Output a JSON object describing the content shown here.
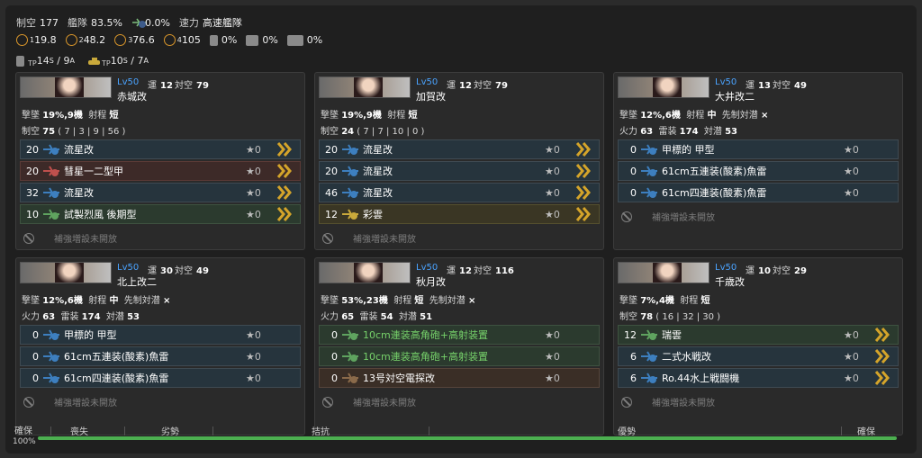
{
  "header": {
    "row1": [
      {
        "label": "制空",
        "value": "177"
      },
      {
        "label": "艦隊",
        "value": "83.5%"
      },
      {
        "label": "",
        "value": "0.0%"
      },
      {
        "label": "速力",
        "value": "高速艦隊"
      }
    ],
    "row2": [
      "19.8",
      "48.2",
      "76.6",
      "105",
      "0%",
      "0%",
      "0%"
    ],
    "row2_subs": [
      "1",
      "2",
      "3",
      "4"
    ],
    "row3": {
      "tp1_a": "14",
      "tp1_b": "9",
      "tp2_a": "10",
      "tp2_b": "7"
    }
  },
  "ships": [
    {
      "level": "Lv50",
      "luck_label": "運",
      "luck": "12",
      "aa_label": "対空",
      "aa": "79",
      "name": "赤城改",
      "stat1": {
        "label1": "撃墜",
        "v1": "19%,9機",
        "label2": "射程",
        "v2": "短"
      },
      "stat2": {
        "label1": "制空",
        "v1": "75",
        "extra": "( 7 | 3 | 9 | 56 )"
      },
      "equips": [
        {
          "slot": "20",
          "name": "流星改",
          "star": "★0",
          "style": "blue",
          "chev": true
        },
        {
          "slot": "20",
          "name": "彗星一二型甲",
          "star": "★0",
          "style": "red",
          "chev": true
        },
        {
          "slot": "32",
          "name": "流星改",
          "star": "★0",
          "style": "blue",
          "chev": true
        },
        {
          "slot": "10",
          "name": "試製烈風 後期型",
          "star": "★0",
          "style": "green",
          "chev": true
        }
      ],
      "ex": "補強増設未開放"
    },
    {
      "level": "Lv50",
      "luck_label": "運",
      "luck": "12",
      "aa_label": "対空",
      "aa": "79",
      "name": "加賀改",
      "stat1": {
        "label1": "撃墜",
        "v1": "19%,9機",
        "label2": "射程",
        "v2": "短"
      },
      "stat2": {
        "label1": "制空",
        "v1": "24",
        "extra": "( 7 | 7 | 10 | 0 )"
      },
      "equips": [
        {
          "slot": "20",
          "name": "流星改",
          "star": "★0",
          "style": "blue",
          "chev": true
        },
        {
          "slot": "20",
          "name": "流星改",
          "star": "★0",
          "style": "blue",
          "chev": true
        },
        {
          "slot": "46",
          "name": "流星改",
          "star": "★0",
          "style": "blue",
          "chev": true
        },
        {
          "slot": "12",
          "name": "彩雲",
          "star": "★0",
          "style": "olive",
          "chev": true
        }
      ],
      "ex": "補強増設未開放"
    },
    {
      "level": "Lv50",
      "luck_label": "運",
      "luck": "13",
      "aa_label": "対空",
      "aa": "49",
      "name": "大井改二",
      "stat1": {
        "label1": "撃墜",
        "v1": "12%,6機",
        "label2": "射程",
        "v2": "中",
        "label3": "先制対潜",
        "v3": "×"
      },
      "stat2": {
        "label1": "火力",
        "v1": "63",
        "label2": "雷装",
        "v2": "174",
        "label3": "対潜",
        "v3": "53"
      },
      "equips": [
        {
          "slot": "0",
          "name": "甲標的 甲型",
          "star": "★0",
          "style": "blue",
          "chev": false
        },
        {
          "slot": "0",
          "name": "61cm五連装(酸素)魚雷",
          "star": "★0",
          "style": "blue",
          "chev": false
        },
        {
          "slot": "0",
          "name": "61cm四連装(酸素)魚雷",
          "star": "★0",
          "style": "blue",
          "chev": false
        }
      ],
      "ex": "補強増設未開放"
    },
    {
      "level": "Lv50",
      "luck_label": "運",
      "luck": "30",
      "aa_label": "対空",
      "aa": "49",
      "name": "北上改二",
      "stat1": {
        "label1": "撃墜",
        "v1": "12%,6機",
        "label2": "射程",
        "v2": "中",
        "label3": "先制対潜",
        "v3": "×"
      },
      "stat2": {
        "label1": "火力",
        "v1": "63",
        "label2": "雷装",
        "v2": "174",
        "label3": "対潜",
        "v3": "53"
      },
      "equips": [
        {
          "slot": "0",
          "name": "甲標的 甲型",
          "star": "★0",
          "style": "blue",
          "chev": false
        },
        {
          "slot": "0",
          "name": "61cm五連装(酸素)魚雷",
          "star": "★0",
          "style": "blue",
          "chev": false
        },
        {
          "slot": "0",
          "name": "61cm四連装(酸素)魚雷",
          "star": "★0",
          "style": "blue",
          "chev": false
        }
      ],
      "ex": "補強増設未開放"
    },
    {
      "level": "Lv50",
      "luck_label": "運",
      "luck": "12",
      "aa_label": "対空",
      "aa": "116",
      "name": "秋月改",
      "stat1": {
        "label1": "撃墜",
        "v1": "53%,23機",
        "label2": "射程",
        "v2": "短",
        "label3": "先制対潜",
        "v3": "×"
      },
      "stat2": {
        "label1": "火力",
        "v1": "65",
        "label2": "雷装",
        "v2": "54",
        "label3": "対潜",
        "v3": "51"
      },
      "equips": [
        {
          "slot": "0",
          "name": "10cm連装高角砲+高射装置",
          "star": "★0",
          "style": "green",
          "chev": false,
          "greentext": true
        },
        {
          "slot": "0",
          "name": "10cm連装高角砲+高射装置",
          "star": "★0",
          "style": "green",
          "chev": false,
          "greentext": true
        },
        {
          "slot": "0",
          "name": "13号対空電探改",
          "star": "★0",
          "style": "brown",
          "chev": false
        }
      ],
      "ex": "補強増設未開放"
    },
    {
      "level": "Lv50",
      "luck_label": "運",
      "luck": "10",
      "aa_label": "対空",
      "aa": "29",
      "name": "千歳改",
      "stat1": {
        "label1": "撃墜",
        "v1": "7%,4機",
        "label2": "射程",
        "v2": "短"
      },
      "stat2": {
        "label1": "制空",
        "v1": "78",
        "extra": "( 16 | 32 | 30 )"
      },
      "equips": [
        {
          "slot": "12",
          "name": "瑞雲",
          "star": "★0",
          "style": "green",
          "chev": true
        },
        {
          "slot": "6",
          "name": "二式水戦改",
          "star": "★0",
          "style": "blue",
          "chev": true
        },
        {
          "slot": "6",
          "name": "Ro.44水上戦闘機",
          "star": "★0",
          "style": "blue",
          "chev": true
        }
      ],
      "ex": "補強増設未開放"
    }
  ],
  "bottom": {
    "left_top": "確保",
    "left_bottom": "100%",
    "labels": [
      "喪失",
      "劣勢",
      "拮抗",
      "優勢",
      "確保"
    ],
    "progress": 1.0
  }
}
